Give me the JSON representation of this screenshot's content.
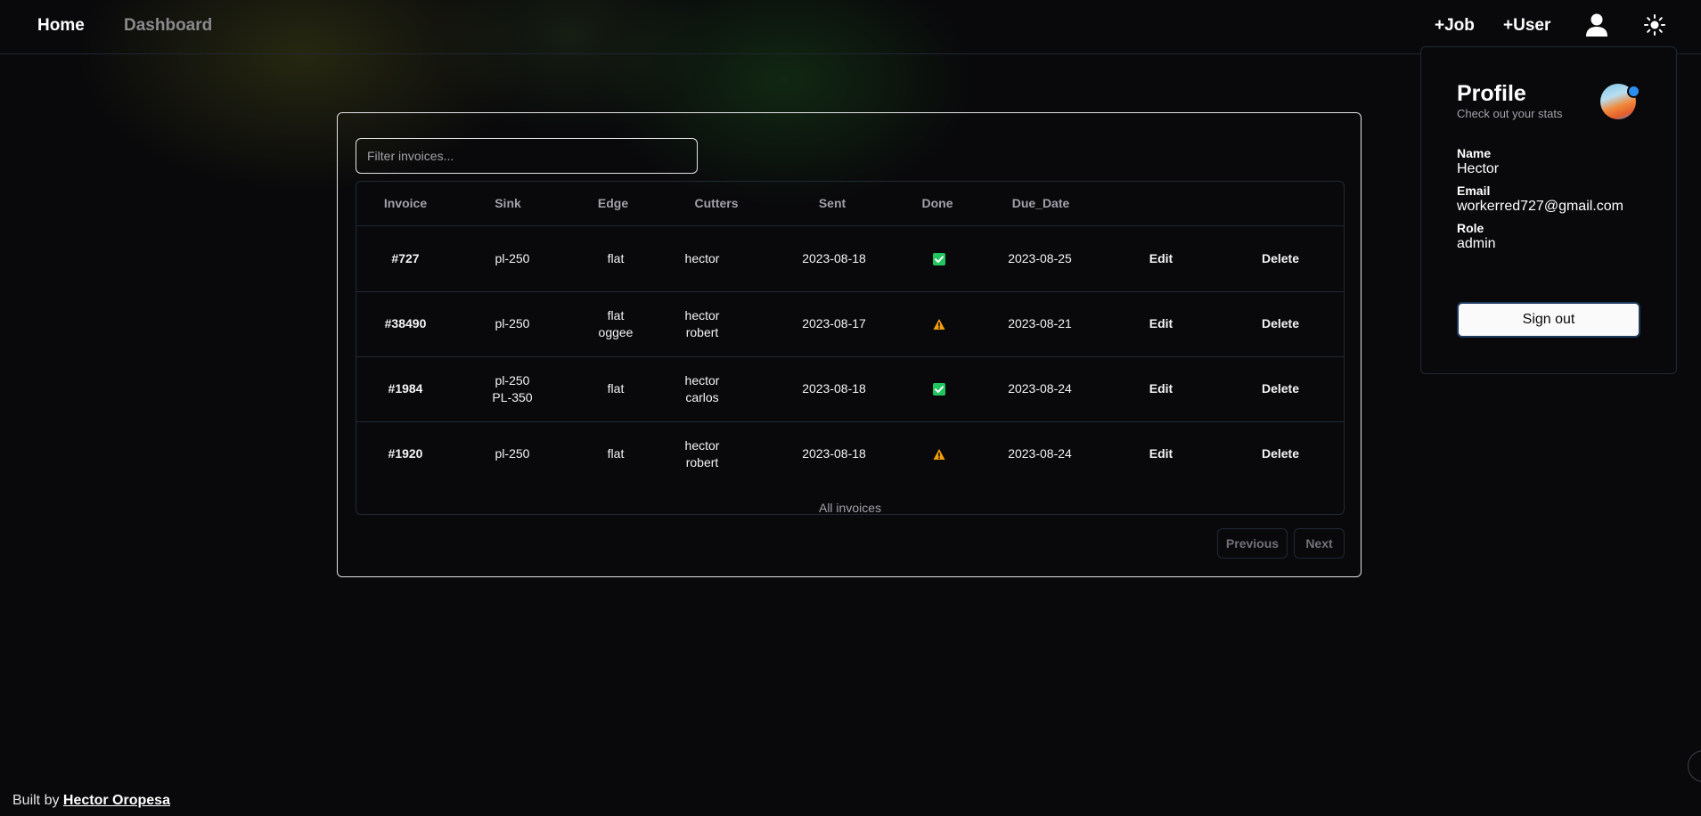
{
  "nav": {
    "home": "Home",
    "dashboard": "Dashboard",
    "add_job": "+Job",
    "add_user": "+User",
    "user_icon": "user-icon",
    "theme_icon": "sun-icon"
  },
  "filter": {
    "placeholder": "Filter invoices..."
  },
  "table": {
    "headers": [
      "Invoice",
      "Sink",
      "Edge",
      "Cutters",
      "Sent",
      "Done",
      "Due_Date"
    ],
    "rows": [
      {
        "invoice": "#727",
        "sink": [
          "pl-250"
        ],
        "edge": [
          "flat"
        ],
        "cutters": [
          "hector"
        ],
        "sent": "2023-08-18",
        "done": "check",
        "due_date": "2023-08-25",
        "edit": "Edit",
        "delete": "Delete"
      },
      {
        "invoice": "#38490",
        "sink": [
          "pl-250"
        ],
        "edge": [
          "flat",
          "oggee"
        ],
        "cutters": [
          "hector",
          "robert"
        ],
        "sent": "2023-08-17",
        "done": "warning",
        "due_date": "2023-08-21",
        "edit": "Edit",
        "delete": "Delete"
      },
      {
        "invoice": "#1984",
        "sink": [
          "pl-250",
          "PL-350"
        ],
        "edge": [
          "flat"
        ],
        "cutters": [
          "hector",
          "carlos"
        ],
        "sent": "2023-08-18",
        "done": "check",
        "due_date": "2023-08-24",
        "edit": "Edit",
        "delete": "Delete"
      },
      {
        "invoice": "#1920",
        "sink": [
          "pl-250"
        ],
        "edge": [
          "flat"
        ],
        "cutters": [
          "hector",
          "robert"
        ],
        "sent": "2023-08-18",
        "done": "warning",
        "due_date": "2023-08-24",
        "edit": "Edit",
        "delete": "Delete"
      }
    ],
    "caption": "All invoices"
  },
  "pagination": {
    "previous": "Previous",
    "next": "Next"
  },
  "profile": {
    "title": "Profile",
    "subtitle": "Check out your stats",
    "name_label": "Name",
    "name": "Hector",
    "email_label": "Email",
    "email": "workerred727@gmail.com",
    "role_label": "Role",
    "role": "admin",
    "sign_out": "Sign out"
  },
  "footer": {
    "text": "Built by ",
    "author": "Hector Oropesa"
  },
  "colors": {
    "background": "#09090b",
    "done_check": "#22c55e",
    "done_warning": "#f59e0b",
    "border": "#e4e4e7"
  }
}
